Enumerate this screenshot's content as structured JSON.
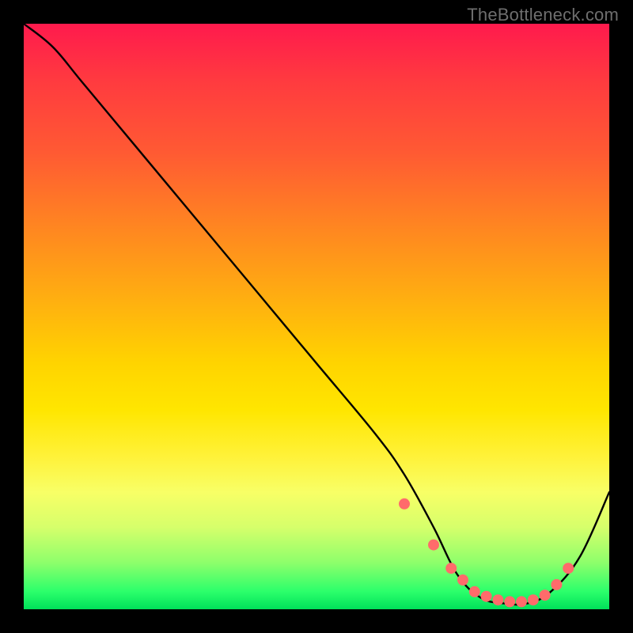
{
  "attribution": "TheBottleneck.com",
  "chart_data": {
    "type": "line",
    "title": "",
    "xlabel": "",
    "ylabel": "",
    "xlim": [
      0,
      100
    ],
    "ylim": [
      0,
      100
    ],
    "series": [
      {
        "name": "bottleneck-curve",
        "x": [
          0,
          5,
          10,
          20,
          30,
          40,
          50,
          60,
          65,
          70,
          74,
          78,
          82,
          86,
          90,
          95,
          100
        ],
        "y": [
          100,
          96,
          90,
          78,
          66,
          54,
          42,
          30,
          23,
          14,
          6,
          2,
          1,
          1,
          3,
          9,
          20
        ]
      }
    ],
    "markers": {
      "name": "highlight-dots",
      "x": [
        65,
        70,
        73,
        75,
        77,
        79,
        81,
        83,
        85,
        87,
        89,
        91,
        93
      ],
      "y": [
        18,
        11,
        7,
        5,
        3,
        2.2,
        1.6,
        1.3,
        1.3,
        1.6,
        2.4,
        4.2,
        7
      ]
    },
    "gradient_stops": [
      {
        "pct": 0,
        "color": "#ff1a4d"
      },
      {
        "pct": 50,
        "color": "#ffd400"
      },
      {
        "pct": 95,
        "color": "#8eff6b"
      },
      {
        "pct": 100,
        "color": "#00e05a"
      }
    ]
  }
}
